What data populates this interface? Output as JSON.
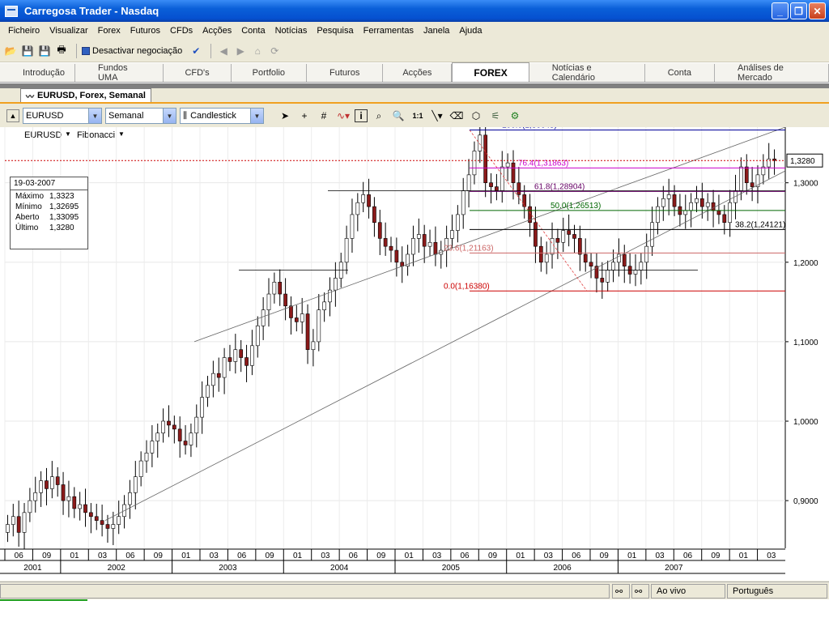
{
  "window": {
    "title": "Carregosa Trader - Nasdaq"
  },
  "menu": [
    "Ficheiro",
    "Visualizar",
    "Forex",
    "Futuros",
    "CFDs",
    "Acções",
    "Conta",
    "Notícias",
    "Pesquisa",
    "Ferramentas",
    "Janela",
    "Ajuda"
  ],
  "toolbar": {
    "deactivate_label": "Desactivar negociação"
  },
  "tabs": [
    {
      "label": "Introdução",
      "active": false
    },
    {
      "label": "Fundos UMA",
      "active": false
    },
    {
      "label": "CFD's",
      "active": false
    },
    {
      "label": "Portfolio",
      "active": false
    },
    {
      "label": "Futuros",
      "active": false
    },
    {
      "label": "Acções",
      "active": false
    },
    {
      "label": "FOREX",
      "active": true
    },
    {
      "label": "Notícias e Calendário",
      "active": false
    },
    {
      "label": "Conta",
      "active": false
    },
    {
      "label": "Análises de Mercado",
      "active": false
    }
  ],
  "chart_window": {
    "tab_label": "EURUSD, Forex, Semanal"
  },
  "chart_toolbar": {
    "symbol": "EURUSD",
    "period": "Semanal",
    "chart_type": "Candlestick"
  },
  "chart_header": {
    "symbol": "EURUSD",
    "study": "Fibonacci"
  },
  "info_box": {
    "date": "19-03-2007",
    "rows": [
      {
        "label": "Máximo",
        "value": "1,3323"
      },
      {
        "label": "Mínimo",
        "value": "1,32695"
      },
      {
        "label": "Aberto",
        "value": "1,33095"
      },
      {
        "label": "Último",
        "value": "1,3280"
      }
    ]
  },
  "price_label": "1,3280",
  "status": {
    "mode": "Ao vivo",
    "language": "Português"
  },
  "colors": {
    "accent": "#0a5fd8",
    "up": "#ffffff",
    "down": "#8b1a1a",
    "last_price_line": "#cc0000"
  },
  "chart_data": {
    "type": "candlestick",
    "symbol": "EURUSD",
    "period": "weekly",
    "yticks": [
      "0,9000",
      "1,0000",
      "1,1000",
      "1,2000",
      "1,3000"
    ],
    "ylim": [
      0.84,
      1.37
    ],
    "x_month_ticks": [
      "06",
      "09",
      "01",
      "03",
      "06",
      "09",
      "01",
      "03",
      "06",
      "09",
      "01",
      "03",
      "06",
      "09",
      "01",
      "03",
      "06",
      "09",
      "01",
      "03",
      "06",
      "09",
      "01",
      "03",
      "06",
      "09",
      "01",
      "03"
    ],
    "x_year_labels": [
      "2001",
      "2002",
      "2003",
      "2004",
      "2005",
      "2006",
      "2007"
    ],
    "fibonacci": [
      {
        "label": "100.0(1,36645)",
        "value": 1.36645,
        "color": "#000099"
      },
      {
        "label": "76.4(1,31863)",
        "value": 1.31863,
        "color": "#cc00cc"
      },
      {
        "label": "61.8(1,28904)",
        "value": 1.28904,
        "color": "#660066"
      },
      {
        "label": "50.0(1,26513)",
        "value": 1.26513,
        "color": "#006600"
      },
      {
        "label": "38.2(1,24121)",
        "value": 1.24121,
        "color": "#000000"
      },
      {
        "label": "23.6(1,21163)",
        "value": 1.21163,
        "color": "#cc6666"
      },
      {
        "label": "0.0(1,16380)",
        "value": 1.1638,
        "color": "#cc0000"
      }
    ],
    "last_price": 1.328,
    "closes": [
      0.87,
      0.88,
      0.86,
      0.885,
      0.9,
      0.91,
      0.925,
      0.915,
      0.93,
      0.92,
      0.9,
      0.905,
      0.89,
      0.895,
      0.885,
      0.88,
      0.875,
      0.87,
      0.865,
      0.87,
      0.88,
      0.895,
      0.91,
      0.93,
      0.95,
      0.96,
      0.975,
      0.985,
      1.0,
      0.995,
      0.99,
      0.975,
      0.97,
      0.985,
      1.005,
      1.03,
      1.045,
      1.06,
      1.055,
      1.08,
      1.075,
      1.09,
      1.08,
      1.07,
      1.095,
      1.12,
      1.14,
      1.16,
      1.175,
      1.16,
      1.145,
      1.13,
      1.125,
      1.135,
      1.09,
      1.1,
      1.14,
      1.15,
      1.165,
      1.18,
      1.2,
      1.23,
      1.26,
      1.275,
      1.285,
      1.27,
      1.25,
      1.23,
      1.22,
      1.215,
      1.2,
      1.195,
      1.21,
      1.23,
      1.235,
      1.22,
      1.225,
      1.21,
      1.215,
      1.23,
      1.24,
      1.26,
      1.29,
      1.31,
      1.34,
      1.36,
      1.3,
      1.295,
      1.29,
      1.32,
      1.325,
      1.3,
      1.285,
      1.27,
      1.25,
      1.22,
      1.2,
      1.21,
      1.23,
      1.225,
      1.24,
      1.235,
      1.23,
      1.21,
      1.2,
      1.195,
      1.18,
      1.175,
      1.19,
      1.2,
      1.21,
      1.195,
      1.185,
      1.19,
      1.2,
      1.22,
      1.25,
      1.27,
      1.28,
      1.285,
      1.27,
      1.26,
      1.265,
      1.275,
      1.28,
      1.27,
      1.275,
      1.265,
      1.26,
      1.25,
      1.275,
      1.29,
      1.32,
      1.3,
      1.295,
      1.31,
      1.32,
      1.33,
      1.328
    ]
  }
}
